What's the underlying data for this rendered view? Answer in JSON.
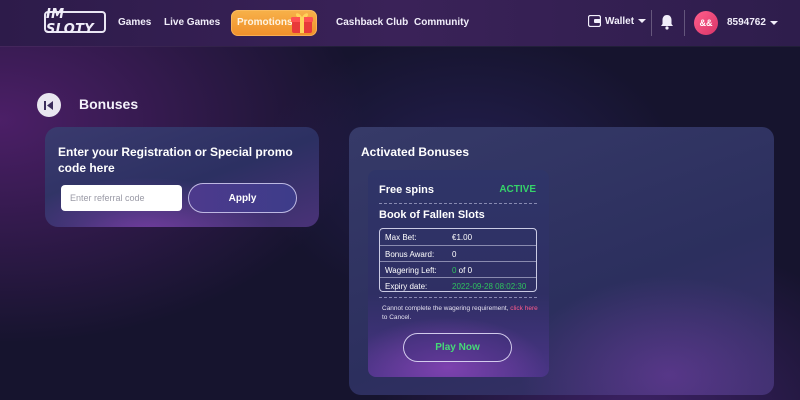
{
  "header": {
    "logo_text": "IM SLOTY",
    "nav": [
      "Games",
      "Live Games",
      "Cashback Club",
      "Community"
    ],
    "promo_label": "Promotions",
    "wallet_label": "Wallet",
    "avatar_initials": "&&",
    "user_id": "8594762",
    "icons": [
      "gift-icon",
      "wallet-icon",
      "chevron-down-icon",
      "bell-icon",
      "avatar"
    ]
  },
  "page": {
    "title": "Bonuses"
  },
  "promo_card": {
    "heading": "Enter your Registration or Special promo code here",
    "input_placeholder": "Enter referral code",
    "input_value": "",
    "apply_label": "Apply"
  },
  "activated": {
    "title": "Activated Bonuses",
    "bonus": {
      "type": "Free spins",
      "status": "ACTIVE",
      "game": "Book of Fallen Slots",
      "rows": {
        "max_bet_label": "Max Bet:",
        "max_bet_value": "€1.00",
        "award_label": "Bonus Award:",
        "award_value": "0",
        "wagering_label": "Wagering Left:",
        "wagering_done": "0",
        "wagering_rest": " of 0",
        "expiry_label": "Expiry date:",
        "expiry_value": "2022-09-28 08:02:30"
      },
      "note_before": "Cannot complete the wagering requirement, ",
      "note_link": "click here",
      "note_after": " to Cancel.",
      "play_label": "Play Now"
    }
  },
  "colors": {
    "status_green": "#35d46a",
    "link_pink": "#ff5b8b",
    "promo_orange": "#f08f2a",
    "background": "#16142e"
  }
}
